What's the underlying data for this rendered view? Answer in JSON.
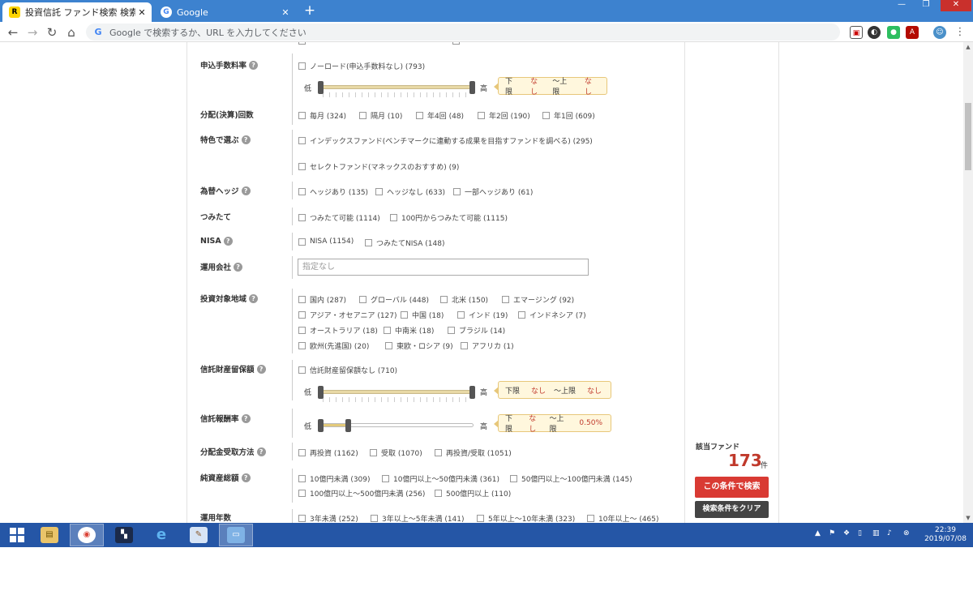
{
  "browser": {
    "tabs": [
      {
        "title": "投資信託 ファンド検索 検索結果",
        "active": true
      },
      {
        "title": "Google",
        "active": false
      }
    ],
    "omnibox_placeholder": "Google で検索するか、URL を入力してください"
  },
  "form": {
    "fee": {
      "label": "申込手数料率",
      "option": "ノーロード(申込手数料なし) (793)",
      "low": "低",
      "high": "高",
      "range": {
        "lower_label": "下限",
        "lower_value": "なし",
        "upper_label": "～上限",
        "upper_value": "なし"
      }
    },
    "distribution_freq": {
      "label": "分配(決算)回数",
      "options": [
        "毎月 (324)",
        "隔月 (10)",
        "年4回 (48)",
        "年2回 (190)",
        "年1回 (609)"
      ]
    },
    "features": {
      "label": "特色で選ぶ",
      "options": [
        "インデックスファンド(ベンチマークに連動する成果を目指すファンドを調べる) (295)",
        "セレクトファンド(マネックスのおすすめ) (9)"
      ]
    },
    "hedge": {
      "label": "為替ヘッジ",
      "options": [
        "ヘッジあり (135)",
        "ヘッジなし (633)",
        "一部ヘッジあり (61)"
      ]
    },
    "tsumitate": {
      "label": "つみたて",
      "options": [
        "つみたて可能 (1114)",
        "100円からつみたて可能 (1115)"
      ]
    },
    "nisa": {
      "label": "NISA",
      "options": [
        "NISA (1154)",
        "つみたてNISA (148)"
      ]
    },
    "company": {
      "label": "運用会社",
      "placeholder": "指定なし"
    },
    "region": {
      "label": "投資対象地域",
      "row1": [
        "国内 (287)",
        "グローバル (448)",
        "北米 (150)",
        "エマージング (92)"
      ],
      "row2": [
        "アジア・オセアニア (127)",
        "中国 (18)",
        "インド (19)",
        "インドネシア (7)"
      ],
      "row3": [
        "オーストラリア (18)",
        "中南米 (18)",
        "ブラジル (14)"
      ],
      "row4": [
        "欧州(先進国) (20)",
        "東欧・ロシア (9)",
        "アフリカ (1)"
      ]
    },
    "trust_reserve": {
      "label": "信託財産留保額",
      "option": "信託財産留保額なし (710)",
      "low": "低",
      "high": "高",
      "range": {
        "lower_label": "下限",
        "lower_value": "なし",
        "upper_label": "～上限",
        "upper_value": "なし"
      }
    },
    "trust_fee": {
      "label": "信託報酬率",
      "low": "低",
      "high": "高",
      "range": {
        "lower_label": "下限",
        "lower_value": "なし",
        "upper_label": "～上限",
        "upper_value": "0.50%"
      }
    },
    "dist_receive": {
      "label": "分配金受取方法",
      "options": [
        "再投資 (1162)",
        "受取 (1070)",
        "再投資/受取 (1051)"
      ]
    },
    "net_assets": {
      "label": "純資産総額",
      "row1": [
        "10億円未満 (309)",
        "10億円以上～50億円未満 (361)",
        "50億円以上～100億円未満 (145)"
      ],
      "row2": [
        "100億円以上～500億円未満 (256)",
        "500億円以上 (110)"
      ]
    },
    "years": {
      "label": "運用年数",
      "options": [
        "3年未満 (252)",
        "3年以上～5年未満 (141)",
        "5年以上～10年未満 (323)",
        "10年以上～ (465)"
      ]
    }
  },
  "results": {
    "label": "該当ファンド",
    "count": "173",
    "unit": "件",
    "search_button": "この条件で検索",
    "clear_button": "検索条件をクリア"
  },
  "taskbar": {
    "time": "22:39",
    "date": "2019/07/08"
  }
}
